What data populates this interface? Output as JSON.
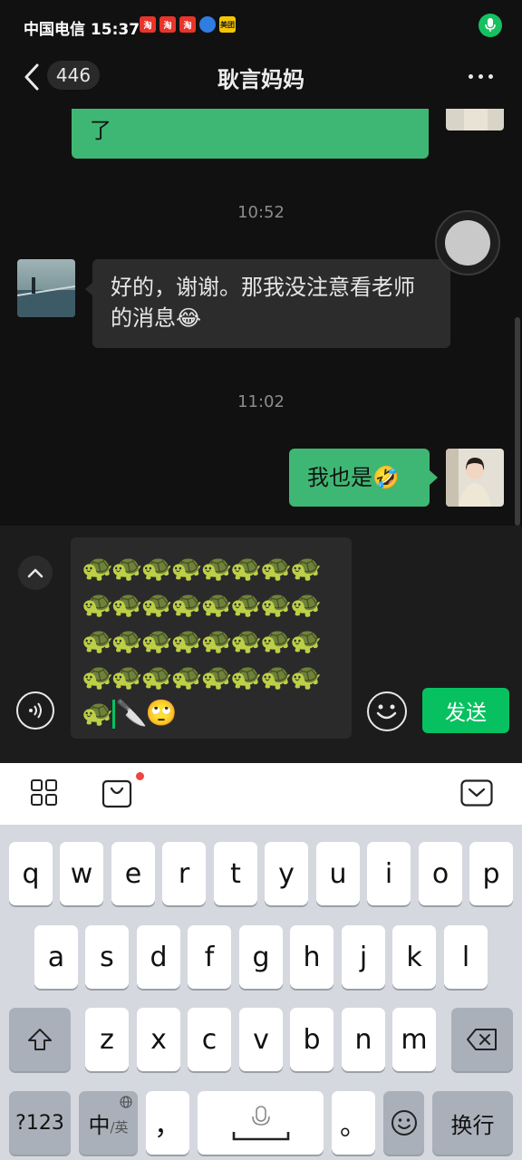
{
  "status_bar": {
    "carrier": "中国电信",
    "time": "15:37",
    "app_icons": [
      {
        "name": "taobao-icon",
        "label": "淘",
        "color": "#e8342b"
      },
      {
        "name": "taobao-icon",
        "label": "淘",
        "color": "#e8342b"
      },
      {
        "name": "taobao-icon",
        "label": "淘",
        "color": "#e8342b"
      },
      {
        "name": "browser-icon",
        "label": "",
        "color": "#2f7de1"
      },
      {
        "name": "meituan-icon",
        "label": "美团",
        "color": "#f7c600"
      }
    ]
  },
  "header": {
    "back_icon": "chevron-left-icon",
    "unread_count": "446",
    "title": "耿言妈妈",
    "more_icon": "more-dots-icon"
  },
  "messages": {
    "m1": {
      "side": "self",
      "text": "了"
    },
    "t1": "10:52",
    "m2": {
      "side": "other",
      "text": "好的，谢谢。那我没注意看老师的消息😂"
    },
    "t2": "11:02",
    "m3": {
      "side": "self",
      "text": "我也是🤣"
    }
  },
  "input": {
    "draft_rows": [
      "🐢🐢🐢🐢🐢🐢🐢🐢",
      "🐢🐢🐢🐢🐢🐢🐢🐢",
      "🐢🐢🐢🐢🐢🐢🐢🐢",
      "🐢🐢🐢🐢🐢🐢🐢🐢"
    ],
    "draft_last_before": "🐢",
    "draft_last_after": "🔪🙄",
    "send_label": "发送"
  },
  "keyboard": {
    "row1": [
      "q",
      "w",
      "e",
      "r",
      "t",
      "y",
      "u",
      "i",
      "o",
      "p"
    ],
    "row2": [
      "a",
      "s",
      "d",
      "f",
      "g",
      "h",
      "j",
      "k",
      "l"
    ],
    "row3": [
      "z",
      "x",
      "c",
      "v",
      "b",
      "n",
      "m"
    ],
    "numbers_label": "?123",
    "lang_label_main": "中",
    "lang_label_sub": "/英",
    "comma_label": "，",
    "period_label": "。",
    "enter_label": "换行"
  },
  "colors": {
    "accent_green": "#07c160",
    "bubble_green": "#3fb774",
    "bubble_gray": "#2c2c2c"
  }
}
